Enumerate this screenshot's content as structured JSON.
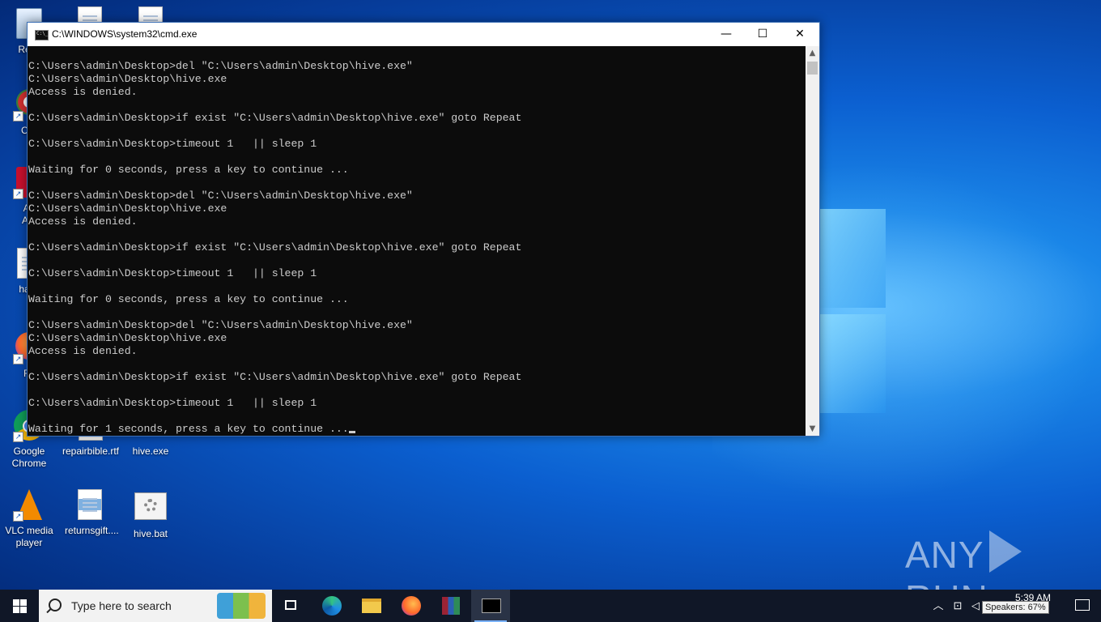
{
  "window": {
    "title": "C:\\WINDOWS\\system32\\cmd.exe",
    "minimize": "—",
    "maximize": "☐",
    "close": "✕"
  },
  "terminal": {
    "lines": [
      "C:\\Users\\admin\\Desktop>del \"C:\\Users\\admin\\Desktop\\hive.exe\"",
      "C:\\Users\\admin\\Desktop\\hive.exe",
      "Access is denied.",
      "",
      "C:\\Users\\admin\\Desktop>if exist \"C:\\Users\\admin\\Desktop\\hive.exe\" goto Repeat",
      "",
      "C:\\Users\\admin\\Desktop>timeout 1   || sleep 1",
      "",
      "Waiting for 0 seconds, press a key to continue ...",
      "",
      "C:\\Users\\admin\\Desktop>del \"C:\\Users\\admin\\Desktop\\hive.exe\"",
      "C:\\Users\\admin\\Desktop\\hive.exe",
      "Access is denied.",
      "",
      "C:\\Users\\admin\\Desktop>if exist \"C:\\Users\\admin\\Desktop\\hive.exe\" goto Repeat",
      "",
      "C:\\Users\\admin\\Desktop>timeout 1   || sleep 1",
      "",
      "Waiting for 0 seconds, press a key to continue ...",
      "",
      "C:\\Users\\admin\\Desktop>del \"C:\\Users\\admin\\Desktop\\hive.exe\"",
      "C:\\Users\\admin\\Desktop\\hive.exe",
      "Access is denied.",
      "",
      "C:\\Users\\admin\\Desktop>if exist \"C:\\Users\\admin\\Desktop\\hive.exe\" goto Repeat",
      "",
      "C:\\Users\\admin\\Desktop>timeout 1   || sleep 1",
      "",
      "Waiting for 1 seconds, press a key to continue ..."
    ]
  },
  "desktop": {
    "icons": {
      "recycle": "Recy",
      "ccleaner": "CCl",
      "acrobat1": "Ad",
      "acrobat2": "Acr",
      "halld": "halld",
      "firefox": "Fir",
      "chrome": "Google Chrome",
      "repairbible": "repairbible.rtf",
      "hive_exe": "hive.exe",
      "vlc": "VLC media player",
      "returnsgift": "returnsgift....",
      "hive_bat": "hive.bat"
    }
  },
  "watermark": {
    "left": "ANY",
    "right": "RUN"
  },
  "taskbar": {
    "search_placeholder": "Type here to search",
    "clock_time": "5:39 AM",
    "speaker_tooltip": "Speakers: 67%"
  }
}
